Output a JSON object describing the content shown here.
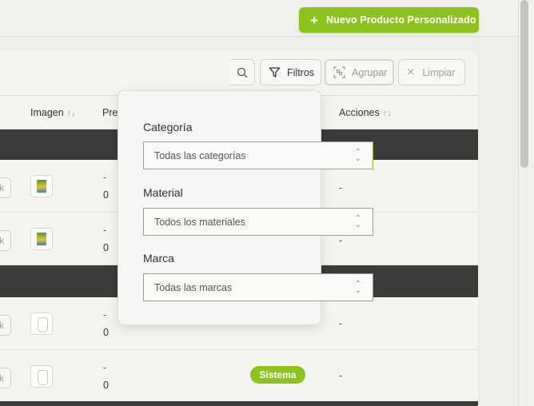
{
  "header": {
    "new_button_label": "Nuevo Producto Personalizado"
  },
  "toolbar": {
    "filters_label": "Filtros",
    "group_label": "Agrupar",
    "clear_label": "Limpiar"
  },
  "table": {
    "columns": [
      {
        "label": "Imagen"
      },
      {
        "label": "Pre"
      },
      {
        "label": "Acciones"
      }
    ],
    "rows": [
      {
        "stub": "k",
        "price_line1": "-",
        "price_line2": "0",
        "action": "-"
      },
      {
        "stub": "k",
        "price_line1": "-",
        "price_line2": "0",
        "action": "-"
      },
      {
        "stub": "k",
        "price_line1": "-",
        "price_line2": "0",
        "action": "-"
      },
      {
        "stub": "k",
        "price_line1": "-",
        "price_line2": "0",
        "badge": "Sistema",
        "action": "-"
      }
    ]
  },
  "filter_panel": {
    "category_label": "Categoría",
    "category_value": "Todas las categorías",
    "material_label": "Material",
    "material_value": "Todos los materiales",
    "brand_label": "Marca",
    "brand_value": "Todas las marcas"
  },
  "colors": {
    "accent": "#8dc21f",
    "group_row": "#3b3b3b",
    "background": "#eeede9"
  }
}
